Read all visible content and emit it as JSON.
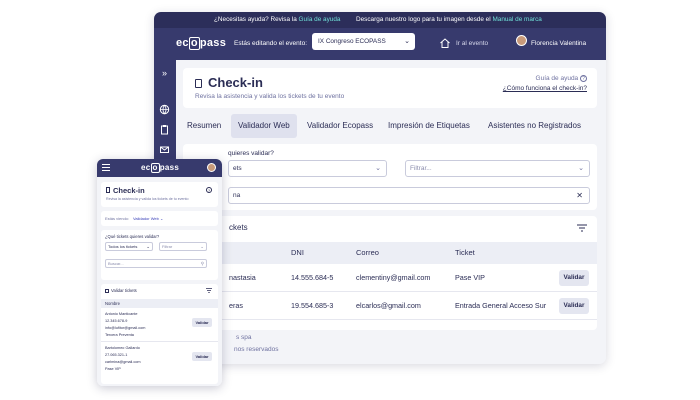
{
  "promo": {
    "help_text": "¿Necesitas ayuda? Revisa la",
    "help_link": "Guía de ayuda",
    "brand_text": "Descarga nuestro logo para tu imagen desde el",
    "brand_link": "Manual de marca"
  },
  "topbar": {
    "logo_pre": "ec",
    "logo_box": "o",
    "logo_post": "pass",
    "editing_label": "Estás editando el evento:",
    "event_select": "IX Congreso ECOPASS",
    "go_event": "Ir al evento",
    "user_name": "Florencia Valentina"
  },
  "page": {
    "title": "Check-in",
    "subtitle": "Revisa la asistencia y valida los tickets de tu evento",
    "help_label": "Guía de ayuda",
    "help_link": "¿Cómo funciona el check-in?"
  },
  "tabs": [
    {
      "label": "Resumen"
    },
    {
      "label": "Validador Web"
    },
    {
      "label": "Validador Ecopass"
    },
    {
      "label": "Impresión de Etiquetas"
    },
    {
      "label": "Asistentes no Registrados"
    }
  ],
  "filters": {
    "question": "quieres validar?",
    "ticket_select": "ets",
    "filter_placeholder": "Filtrar...",
    "search_value": "na"
  },
  "tickets": {
    "title": "ckets",
    "columns": [
      "DNI",
      "Correo",
      "Ticket"
    ],
    "rows": [
      {
        "name": "nastasia",
        "dni": "14.555.684-5",
        "email": "clementiny@gmail.com",
        "ticket": "Pase VIP",
        "action": "Validar"
      },
      {
        "name": "eras",
        "dni": "19.554.685-3",
        "email": "elcarlos@gmail.com",
        "ticket": "Entrada General Acceso Sur",
        "action": "Validar"
      }
    ]
  },
  "footer": {
    "line1": "s spa",
    "line2": "nos reservados"
  },
  "mobile": {
    "title": "Check-in",
    "subtitle": "Revisa la asistencia y valida los tickets de tu evento",
    "event_label": "Estás viendo:",
    "event_value": "Validador Web",
    "question": "¿Qué tickets quieres validar?",
    "ticket_select": "Todos los tickets",
    "filter_placeholder": "Filtrar",
    "search_placeholder": "Buscar...",
    "validate_title": "Validar tickets",
    "name_col": "Nombre",
    "entries": [
      {
        "name": "Antonio Manticante",
        "dni": "12.345.678-9",
        "email": "info@lufitor@gmail.com",
        "ticket": "Tercera Preventa",
        "action": "Validar"
      },
      {
        "name": "Bartolomeo Gallardo",
        "dni": "27.065.321-1",
        "email": "carlmina@gmail.com",
        "ticket": "Pase VIP",
        "action": "Validar"
      }
    ]
  },
  "colors": {
    "nav": "#373a6d",
    "promo": "#2c2e5a",
    "link": "#6fe0d8",
    "active_tab": "#dfe1ee"
  }
}
